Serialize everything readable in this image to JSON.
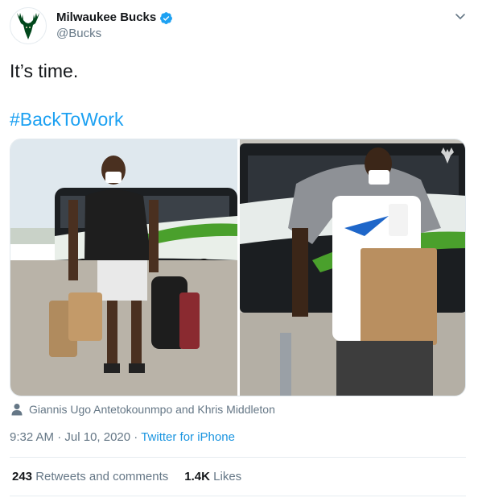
{
  "author": {
    "name": "Milwaukee Bucks",
    "handle": "@Bucks",
    "verified": true,
    "avatar_icon": "bucks-deer-logo",
    "avatar_color": "#00471b"
  },
  "tweet": {
    "text": "It’s time.",
    "hashtag": "#BackToWork",
    "hashtag_color": "#1da1f2"
  },
  "media": {
    "photos": [
      {
        "alt_icon": "photo-left"
      },
      {
        "alt_icon": "photo-right"
      }
    ]
  },
  "people_tag": {
    "icon": "person-icon",
    "text": "Giannis Ugo Antetokounmpo and Khris Middleton"
  },
  "meta": {
    "time": "9:32 AM",
    "separator": "·",
    "date": "Jul 10, 2020",
    "source": "Twitter for iPhone"
  },
  "stats": {
    "retweets_count": "243",
    "retweets_label": "Retweets and comments",
    "likes_count": "1.4K",
    "likes_label": "Likes"
  }
}
